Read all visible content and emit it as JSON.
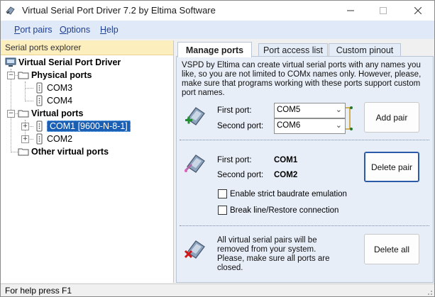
{
  "window": {
    "title": "Virtual Serial Port Driver 7.2 by Eltima Software"
  },
  "menu": {
    "items": [
      {
        "label": "Port pairs",
        "mnemonic": "P"
      },
      {
        "label": "Options",
        "mnemonic": "O"
      },
      {
        "label": "Help",
        "mnemonic": "H"
      }
    ]
  },
  "explorer": {
    "header": "Serial ports explorer",
    "root": "Virtual Serial Port Driver",
    "physical": {
      "label": "Physical ports",
      "ports": [
        "COM3",
        "COM4"
      ]
    },
    "virtual": {
      "label": "Virtual ports",
      "ports": [
        "COM1 [9600-N-8-1]",
        "COM2"
      ]
    },
    "other": "Other virtual ports"
  },
  "tabs": [
    "Manage ports",
    "Port access list",
    "Custom pinout"
  ],
  "manage": {
    "description": "VSPD by Eltima can create virtual serial ports with any names you like, so you are not limited to COMx names only. However, please, make sure that programs working with these ports support custom port names.",
    "first_port_label": "First port:",
    "second_port_label": "Second port:",
    "first_port_value": "COM5",
    "second_port_value": "COM6",
    "add_pair": "Add pair",
    "pair_first_label": "First port:",
    "pair_second_label": "Second port:",
    "pair_first_value": "COM1",
    "pair_second_value": "COM2",
    "delete_pair": "Delete pair",
    "strict_baudrate": "Enable strict baudrate emulation",
    "break_line": "Break line/Restore connection",
    "delete_all_text": "All virtual serial pairs will be removed from your system. Please, make sure all ports are closed.",
    "delete_all": "Delete all"
  },
  "status": {
    "text": "For help press F1"
  },
  "colors": {
    "accent": "#1a5fb4",
    "menu_text": "#1f3f91",
    "explorer_header": "#fdeebd",
    "panel_bg": "#e8eef8"
  }
}
